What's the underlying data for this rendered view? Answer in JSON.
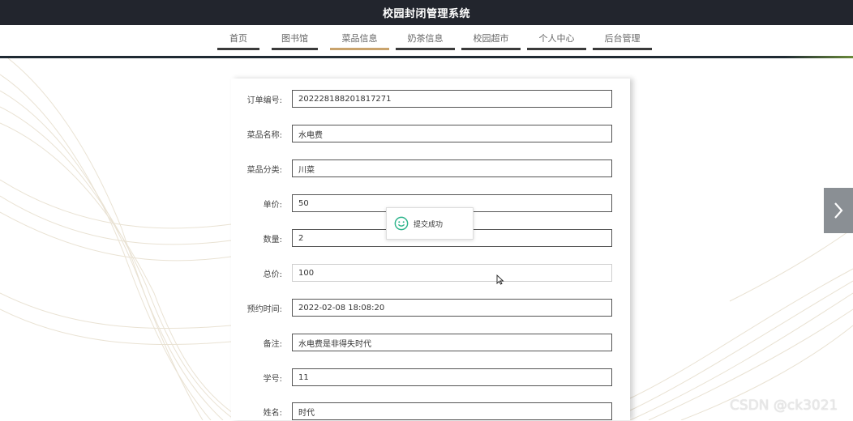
{
  "app": {
    "title": "校园封闭管理系统"
  },
  "nav": {
    "items": [
      {
        "label": "首页",
        "active": false
      },
      {
        "label": "图书馆",
        "active": false
      },
      {
        "label": "菜品信息",
        "active": true
      },
      {
        "label": "奶茶信息",
        "active": false
      },
      {
        "label": "校园超市",
        "active": false
      },
      {
        "label": "个人中心",
        "active": false
      },
      {
        "label": "后台管理",
        "active": false
      }
    ],
    "accent_color": "#c9a36c"
  },
  "form": {
    "fields": [
      {
        "label": "订单编号:",
        "value": "202228188201817271"
      },
      {
        "label": "菜品名称:",
        "value": "水电费"
      },
      {
        "label": "菜品分类:",
        "value": "川菜"
      },
      {
        "label": "单价:",
        "value": "50"
      },
      {
        "label": "数量:",
        "value": "2"
      },
      {
        "label": "总价:",
        "value": "100"
      },
      {
        "label": "预约时间:",
        "value": "2022-02-08 18:08:20"
      },
      {
        "label": "备注:",
        "value": "水电费是非得失时代"
      },
      {
        "label": "学号:",
        "value": "11"
      },
      {
        "label": "姓名:",
        "value": "时代"
      }
    ]
  },
  "toast": {
    "message": "提交成功",
    "icon": "smile-icon",
    "color": "#2bb38a"
  },
  "carousel": {
    "next_icon": "chevron-right-icon"
  },
  "watermark": {
    "text": "CSDN @ck3021"
  }
}
